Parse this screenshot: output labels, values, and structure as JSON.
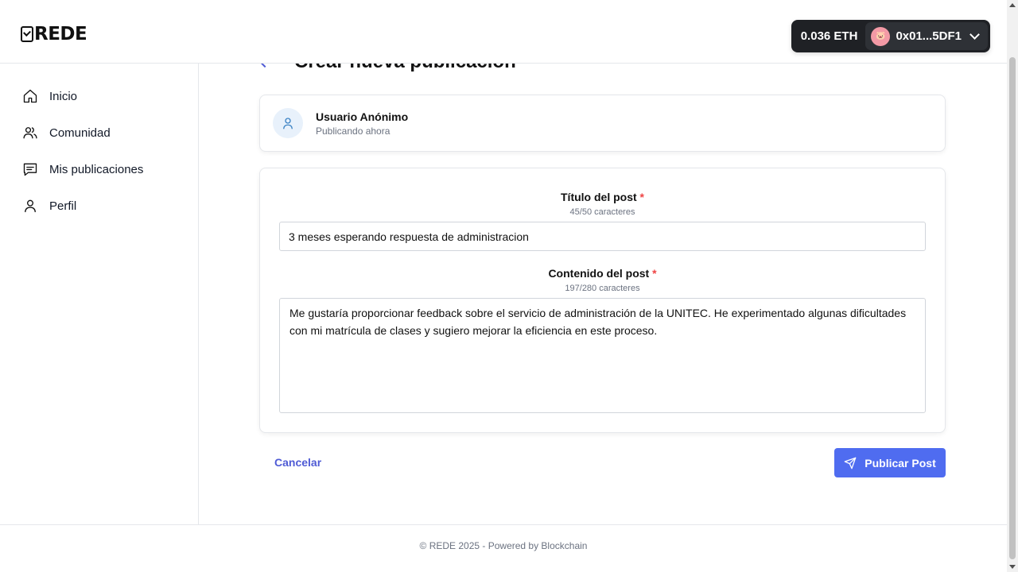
{
  "brand": {
    "name": "REDE"
  },
  "wallet": {
    "balance": "0.036 ETH",
    "address": "0x01...5DF1",
    "avatar_icon": "pig-icon"
  },
  "sidebar": {
    "items": [
      {
        "label": "Inicio",
        "icon": "home-icon"
      },
      {
        "label": "Comunidad",
        "icon": "users-icon"
      },
      {
        "label": "Mis publicaciones",
        "icon": "message-icon"
      },
      {
        "label": "Perfil",
        "icon": "user-icon"
      }
    ]
  },
  "page": {
    "title": "Crear nueva publicación"
  },
  "author": {
    "name": "Usuario Anónimo",
    "subtitle": "Publicando ahora"
  },
  "form": {
    "title_label": "Título del post",
    "required_mark": "*",
    "title_counter": "45/50 caracteres",
    "title_value": "3 meses esperando respuesta de administracion",
    "content_label": "Contenido del post",
    "content_counter": "197/280 caracteres",
    "content_value": "Me gustaría proporcionar feedback sobre el servicio de administración de la UNITEC. He experimentado algunas dificultades con mi matrícula de clases y sugiero mejorar la eficiencia en este proceso."
  },
  "actions": {
    "cancel_label": "Cancelar",
    "publish_label": "Publicar Post"
  },
  "footer": {
    "text": "© REDE 2025 - Powered by Blockchain"
  },
  "colors": {
    "accent": "#4f6cf0",
    "required": "#ef4444",
    "wallet_bg": "#1f2125"
  }
}
